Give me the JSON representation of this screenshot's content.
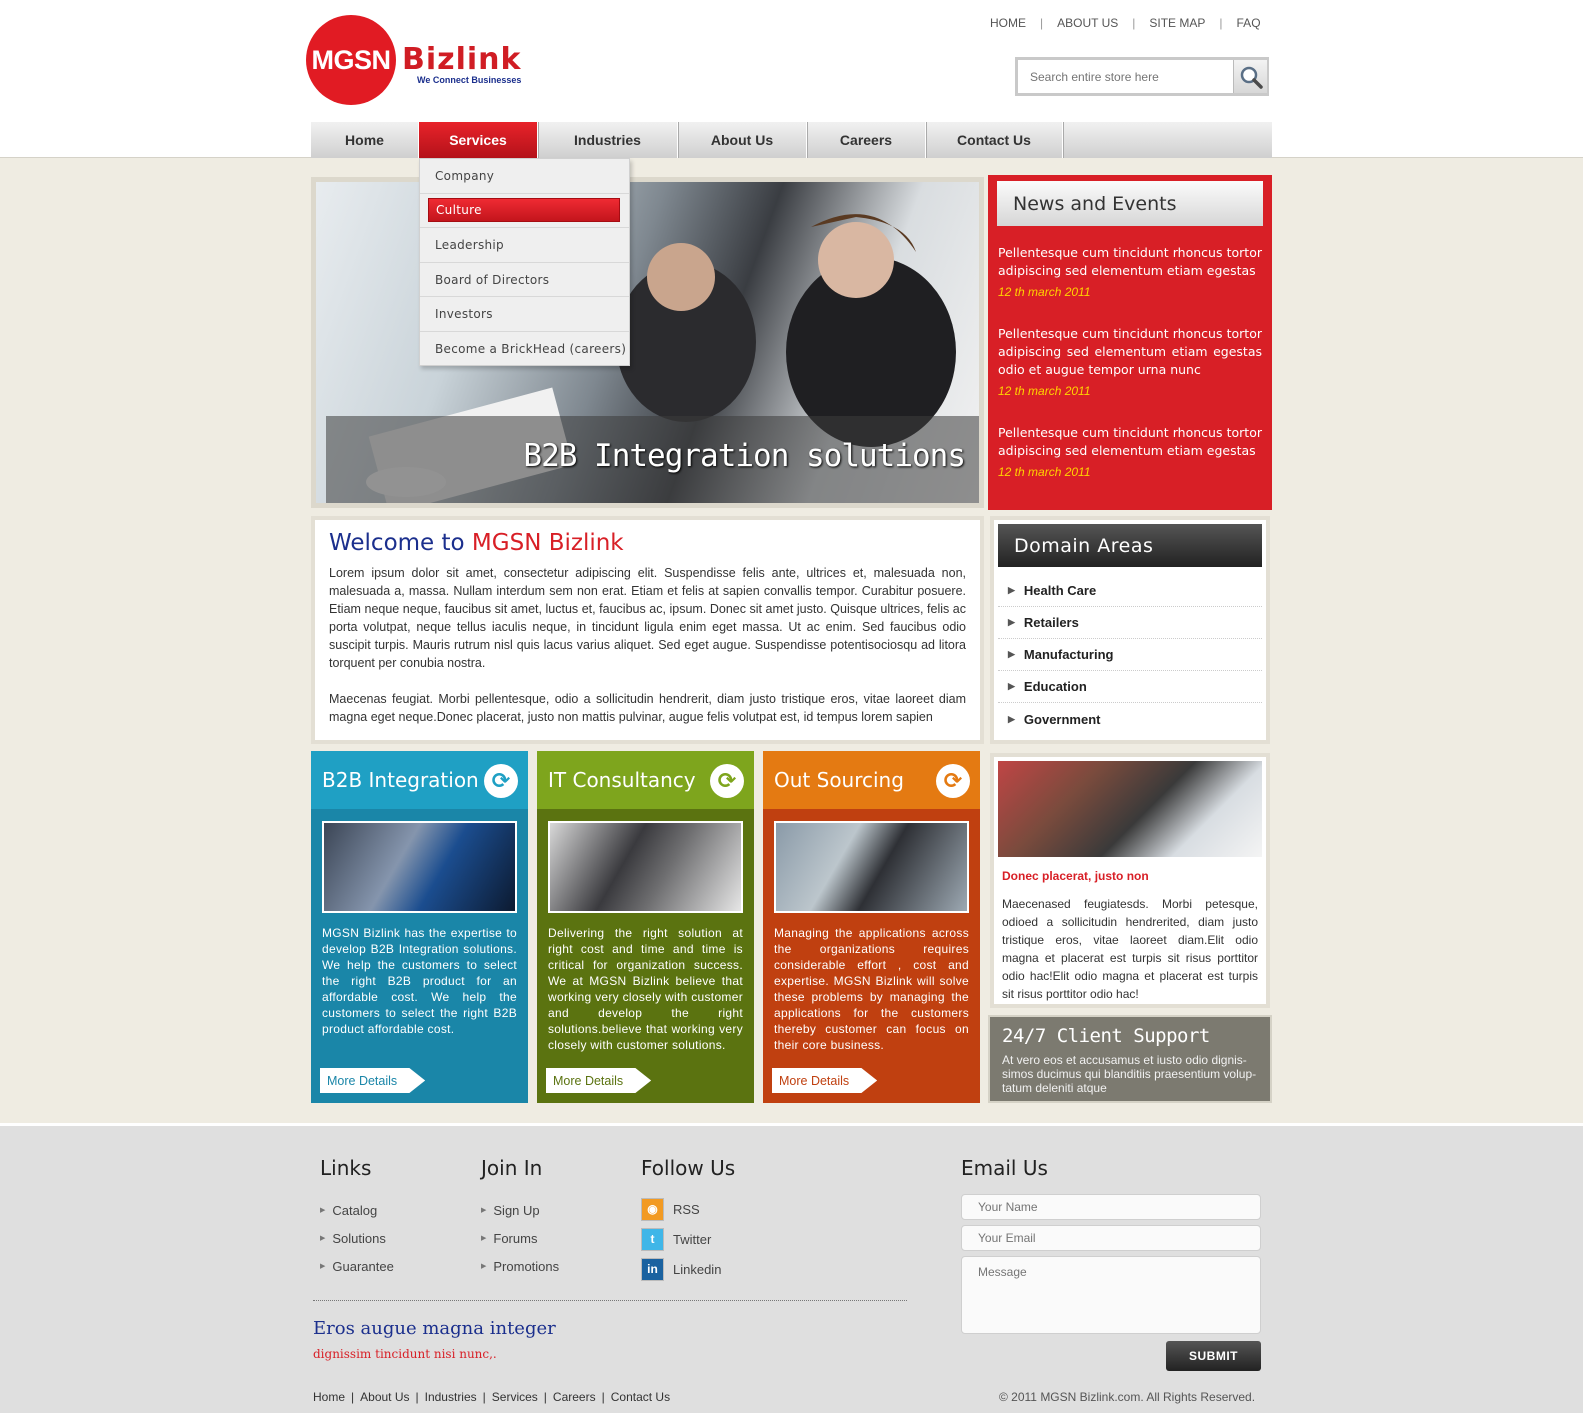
{
  "brand": {
    "logo_text": "MGSN",
    "logo_word": "Bizlink",
    "tagline": "We Connect Businesses"
  },
  "top_links": [
    "HOME",
    "ABOUT US",
    "SITE MAP",
    "FAQ"
  ],
  "search": {
    "placeholder": "Search entire store here",
    "icon": "magnifier-icon"
  },
  "nav": [
    "Home",
    "Services",
    "Industries",
    "About Us",
    "Careers",
    "Contact Us"
  ],
  "dropdown": [
    "Company",
    "Culture",
    "Leadership",
    "Board of Directors",
    "Investors",
    "Become a BrickHead (careers)"
  ],
  "hero": {
    "caption": "B2B Integration solutions"
  },
  "news": {
    "title": "News and Events",
    "items": [
      {
        "text": "Pellentesque cum tincidunt rhoncus tortor adipiscing sed elementum etiam egestas",
        "date": "12 th  march  2011"
      },
      {
        "text": "Pellentesque cum tincidunt rhoncus tortor adipiscing sed elementum etiam egestas odio et augue tempor urna nunc",
        "date": "12 th  march  2011"
      },
      {
        "text": "Pellentesque cum tincidunt rhoncus tortor adipiscing sed elementum etiam egestas",
        "date": "12 th  march  2011"
      }
    ]
  },
  "welcome": {
    "title_a": "Welcome to ",
    "title_b": "MGSN Bizlink",
    "p1": "Lorem ipsum dolor sit amet, consectetur adipiscing elit. Suspendisse felis ante, ultrices et, malesuada non, malesuada a, massa. Nullam interdum sem non erat. Etiam et felis at sapien convallis tempor. Curabitur posuere. Etiam neque neque, faucibus sit amet, luctus et, faucibus ac, ipsum. Donec sit amet justo. Quisque ultrices, felis ac porta volutpat, neque tellus iaculis neque, in tincidunt ligula enim eget massa. Ut ac enim. Sed faucibus odio suscipit turpis. Mauris rutrum nisl quis lacus varius aliquet. Sed eget augue. Suspendisse potentisociosqu ad litora torquent per conubia nostra.",
    "p2": "Maecenas feugiat. Morbi pellentesque, odio a sollicitudin hendrerit, diam justo tristique eros, vitae laoreet diam magna eget neque.Donec placerat, justo non mattis pulvinar, augue felis volutpat est, id tempus lorem sapien"
  },
  "domain": {
    "title": "Domain Areas",
    "items": [
      "Health Care",
      "Retailers",
      "Manufacturing",
      "Education",
      "Government"
    ]
  },
  "services": [
    {
      "title": "B2B Integration",
      "color": "#1a86a8",
      "head": "#1fa0c4",
      "text": "MGSN Bizlink has the expertise to develop B2B Integration solutions. We help the customers to select the right B2B product for an affordable cost. We help the customers to select the right B2B product affordable cost.",
      "button": "More Details"
    },
    {
      "title": "IT Consultancy",
      "color": "#5b7310",
      "head": "#7ea51d",
      "text": "Delivering the right solution at right cost and time and time is critical for organization success. We at MGSN Bizlink believe that working very closely with customer and develop the right solutions.believe that working very closely with customer solutions.",
      "button": "More Details"
    },
    {
      "title": "Out Sourcing",
      "color": "#c04010",
      "head": "#e47a12",
      "text": "Managing the applications across the organizations requires considerable effort , cost and expertise. MGSN Bizlink will solve these problems by managing the applications for the customers thereby customer can focus on their core business.",
      "button": "More Details"
    }
  ],
  "promo": {
    "title": "Donec placerat, justo non",
    "text": "Maecenased feugiatesds. Morbi petesque, odioed a sollicitudin hendrerited, diam justo tristique eros, vitae laoreet diam.Elit odio magna et placerat est turpis sit risus porttitor odio hac!Elit odio magna et placerat est turpis sit risus porttitor odio hac!"
  },
  "support": {
    "title": "24/7 Client Support",
    "text": "At vero eos et accusamus et iusto odio dignis- simos ducimus qui blanditiis praesentium volup- tatum deleniti atque"
  },
  "footer": {
    "links_title": "Links",
    "links": [
      "Catalog",
      "Solutions",
      "Guarantee"
    ],
    "join_title": "Join In",
    "join": [
      "Sign Up",
      "Forums",
      "Promotions"
    ],
    "follow_title": "Follow Us",
    "follow": [
      {
        "label": "RSS",
        "icon": "rss-icon",
        "color": "#f29a22"
      },
      {
        "label": "Twitter",
        "icon": "twitter-icon",
        "color": "#3fb6e8"
      },
      {
        "label": "Linkedin",
        "icon": "linkedin-icon",
        "color": "#1a62a0"
      }
    ],
    "email_title": "Email Us",
    "name_placeholder": "Your Name",
    "email_placeholder": "Your Email",
    "message_placeholder": "Message",
    "submit": "SUBMIT",
    "tag1": "Eros augue magna integer",
    "tag2": "dignissim tincidunt nisi nunc,.",
    "bottom_links": [
      "Home",
      "About Us",
      "Industries",
      "Services",
      "Careers",
      "Contact Us"
    ],
    "copyright": "© 2011 MGSN Bizlink.com. All Rights Reserved."
  }
}
